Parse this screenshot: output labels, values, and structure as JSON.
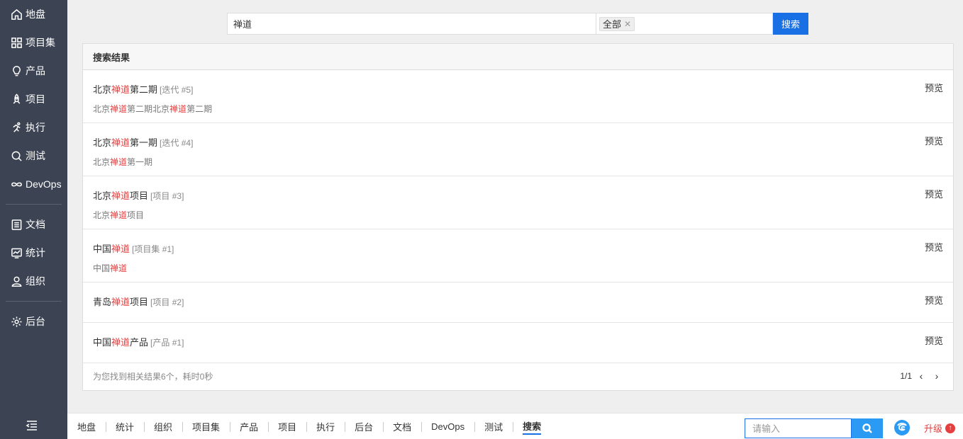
{
  "sidebar": {
    "items": [
      {
        "label": "地盘",
        "icon": "home-icon"
      },
      {
        "label": "项目集",
        "icon": "grid-icon"
      },
      {
        "label": "产品",
        "icon": "lightbulb-icon"
      },
      {
        "label": "项目",
        "icon": "rocket-icon"
      },
      {
        "label": "执行",
        "icon": "running-icon"
      },
      {
        "label": "测试",
        "icon": "magnifier-icon"
      },
      {
        "label": "DevOps",
        "icon": "infinity-icon"
      },
      {
        "label": "文档",
        "icon": "document-icon"
      },
      {
        "label": "统计",
        "icon": "chart-icon"
      },
      {
        "label": "组织",
        "icon": "user-icon"
      },
      {
        "label": "后台",
        "icon": "gear-icon"
      }
    ]
  },
  "search": {
    "query": "禅道",
    "scope_tag": "全部",
    "button": "搜索"
  },
  "results": {
    "header": "搜索结果",
    "preview_label": "预览",
    "items": [
      {
        "pre": "北京",
        "hl": "禅道",
        "post": "第二期",
        "tag": "[迭代 #5]",
        "desc": [
          {
            "t": "北京"
          },
          {
            "t": "禅道",
            "h": true
          },
          {
            "t": "第二期北京"
          },
          {
            "t": "禅道",
            "h": true
          },
          {
            "t": "第二期"
          }
        ]
      },
      {
        "pre": "北京",
        "hl": "禅道",
        "post": "第一期",
        "tag": "[迭代 #4]",
        "desc": [
          {
            "t": "北京"
          },
          {
            "t": "禅道",
            "h": true
          },
          {
            "t": "第一期"
          }
        ]
      },
      {
        "pre": "北京",
        "hl": "禅道",
        "post": "项目",
        "tag": "[项目 #3]",
        "desc": [
          {
            "t": "北京"
          },
          {
            "t": "禅道",
            "h": true
          },
          {
            "t": "项目"
          }
        ]
      },
      {
        "pre": "中国",
        "hl": "禅道",
        "post": "",
        "tag": "[项目集 #1]",
        "desc": [
          {
            "t": "中国"
          },
          {
            "t": "禅道",
            "h": true
          }
        ]
      },
      {
        "pre": "青岛",
        "hl": "禅道",
        "post": "项目",
        "tag": "[项目 #2]",
        "desc": []
      },
      {
        "pre": "中国",
        "hl": "禅道",
        "post": "产品",
        "tag": "[产品 #1]",
        "desc": []
      }
    ],
    "summary": "为您找到相关结果6个，耗时0秒",
    "pager": "1/1"
  },
  "bottom_bar": {
    "tabs": [
      "地盘",
      "统计",
      "组织",
      "项目集",
      "产品",
      "项目",
      "执行",
      "后台",
      "文档",
      "DevOps",
      "测试",
      "搜索"
    ],
    "active_tab": "搜索",
    "search_placeholder": "请输入",
    "upgrade": "升级"
  },
  "colors": {
    "sidebar_bg": "#3c4353",
    "primary": "#1970e4",
    "highlight": "#e53e3e"
  }
}
